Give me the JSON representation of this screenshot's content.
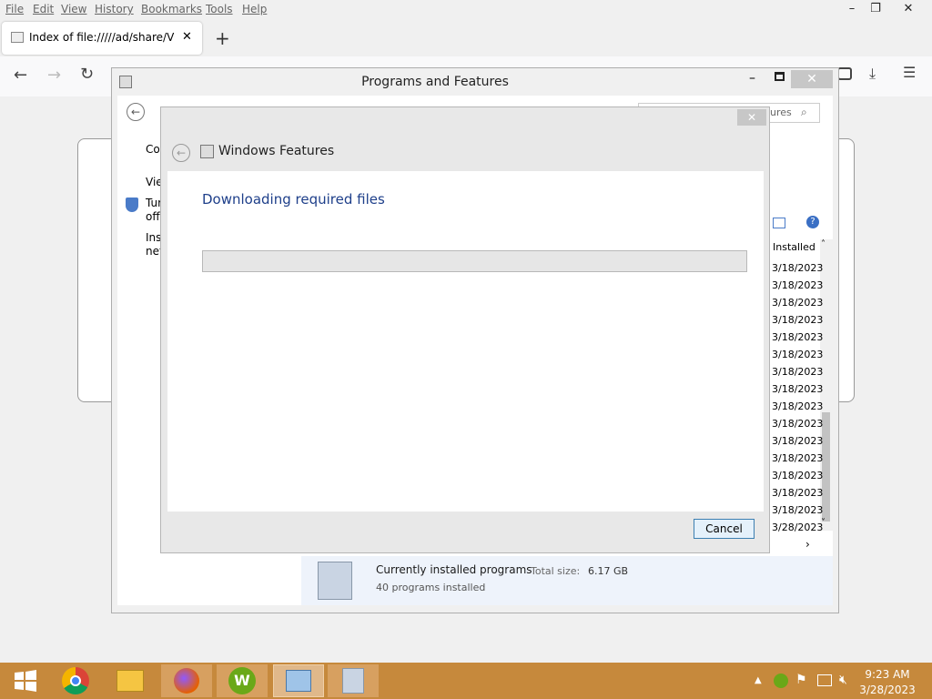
{
  "browser": {
    "menu": [
      "File",
      "Edit",
      "View",
      "History",
      "Bookmarks",
      "Tools",
      "Help"
    ],
    "tab_title": "Index of file://///ad/share/VC R",
    "window_controls": {
      "minimize": "–",
      "restore": "❐",
      "close": "✕"
    },
    "new_tab": "+"
  },
  "programs_window": {
    "title": "Programs and Features",
    "search_placeholder": "ures",
    "sidebar": {
      "item1": "Co",
      "item2": "Vie",
      "item3a": "Tur",
      "item3b": "off",
      "item4a": "Inst",
      "item4b": "net"
    },
    "column_header": "Installed",
    "dates": [
      "3/18/2023",
      "3/18/2023",
      "3/18/2023",
      "3/18/2023",
      "3/18/2023",
      "3/18/2023",
      "3/18/2023",
      "3/18/2023",
      "3/18/2023",
      "3/18/2023",
      "3/18/2023",
      "3/18/2023",
      "3/18/2023",
      "3/18/2023",
      "3/18/2023",
      "3/28/2023"
    ],
    "footer": {
      "label": "Currently installed programs",
      "total_label": "Total size:",
      "total_value": "6.17 GB",
      "count": "40 programs installed"
    }
  },
  "features_dialog": {
    "title": "Windows Features",
    "heading": "Downloading required files",
    "progress": 0,
    "cancel": "Cancel"
  },
  "taskbar": {
    "time": "9:23 AM",
    "date": "3/28/2023"
  }
}
